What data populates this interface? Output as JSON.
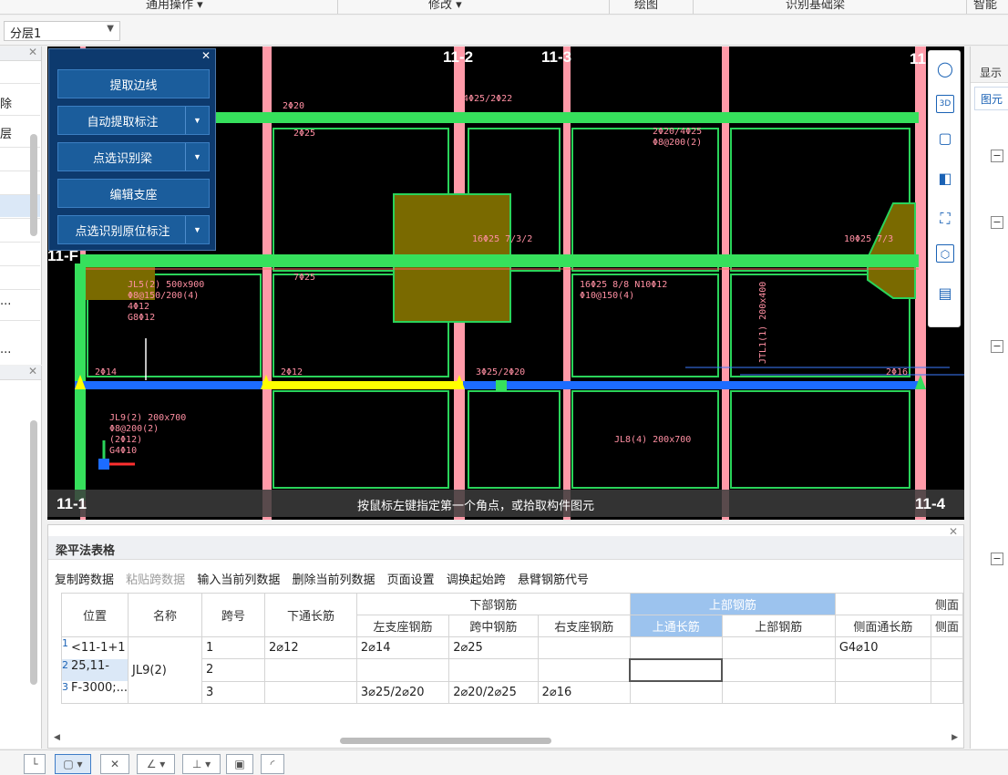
{
  "ribbon": {
    "items": [
      "通用操作 ▾",
      "修改 ▾",
      "绘图",
      "识别基础梁",
      "智能布"
    ]
  },
  "layer": {
    "selected": "分层1"
  },
  "left_panel": {
    "labels": [
      "除",
      "层",
      "...",
      "..."
    ]
  },
  "canvas": {
    "axis_labels": [
      "11-2",
      "11-3",
      "11-F",
      "11-1",
      "11-4",
      "11"
    ],
    "status_message": "按鼠标左键指定第一个角点，或拾取构件图元",
    "annotations": [
      "JL5(2) 500x900",
      "Φ8@150/200(4)",
      "4Φ12",
      "G8Φ12",
      "JL9(2) 200x700",
      "Φ8@200(2)",
      "(2Φ12)",
      "G4Φ10",
      "JL8(4) 200x700",
      "JTL1(1) 200x400",
      "16Φ25 7/3/2",
      "16Φ25 8/8 N10Φ12",
      "Φ10@150(4)",
      "4Φ25/2Φ22",
      "3Φ25/2Φ20",
      "2Φ20/4Φ25",
      "Φ8@200(2)",
      "2Φ20",
      "2Φ25",
      "7Φ25",
      "2Φ14",
      "2Φ12",
      "2Φ16",
      "10Φ25 7/3"
    ]
  },
  "tool_panel": {
    "buttons": [
      {
        "label": "提取边线",
        "dropdown": false
      },
      {
        "label": "自动提取标注",
        "dropdown": true
      },
      {
        "label": "点选识别梁",
        "dropdown": true
      },
      {
        "label": "编辑支座",
        "dropdown": false
      },
      {
        "label": "点选识别原位标注",
        "dropdown": true
      }
    ]
  },
  "right_toolbar": {
    "icons": [
      "orbit-icon",
      "3d-view-icon",
      "box-view-icon",
      "solid-view-icon",
      "zoom-extents-icon",
      "display-filter-icon",
      "properties-sheet-icon"
    ],
    "badge_3d": "3D"
  },
  "right_panel": {
    "title": "显示",
    "tab": "图元"
  },
  "beam_table": {
    "title": "梁平法表格",
    "actions": [
      {
        "label": "复制跨数据",
        "enabled": true
      },
      {
        "label": "粘贴跨数据",
        "enabled": false
      },
      {
        "label": "输入当前列数据",
        "enabled": true
      },
      {
        "label": "删除当前列数据",
        "enabled": true
      },
      {
        "label": "页面设置",
        "enabled": true
      },
      {
        "label": "调换起始跨",
        "enabled": true
      },
      {
        "label": "悬臂钢筋代号",
        "enabled": true
      }
    ],
    "headers": {
      "position": "位置",
      "name": "名称",
      "span": "跨号",
      "bottom_through": "下通长筋",
      "bottom_group": "下部钢筋",
      "left_support": "左支座钢筋",
      "mid_span": "跨中钢筋",
      "right_support": "右支座钢筋",
      "top_group": "上部钢筋",
      "top_through": "上通长筋",
      "top_bar": "上部钢筋",
      "side_group": "侧面",
      "side_through": "侧面通长筋",
      "side_extra": "侧面"
    },
    "position_lines": [
      "<11-1+1",
      "25,11-",
      "F-3000;..."
    ],
    "name": "JL9(2)",
    "rows": [
      {
        "num": "1",
        "span": "1",
        "bottom_through": "2⌀12",
        "left_support": "2⌀14",
        "mid_span": "2⌀25",
        "right_support": "",
        "top_through": "",
        "top_bar": "",
        "side_through": "G4⌀10"
      },
      {
        "num": "2",
        "span": "2",
        "bottom_through": "",
        "left_support": "",
        "mid_span": "",
        "right_support": "",
        "top_through": "",
        "top_bar": "",
        "side_through": ""
      },
      {
        "num": "3",
        "span": "3",
        "bottom_through": "",
        "left_support": "3⌀25/2⌀20",
        "mid_span": "2⌀20/2⌀25",
        "right_support": "2⌀16",
        "top_through": "",
        "top_bar": "",
        "side_through": ""
      }
    ]
  },
  "bottom_toolbar": {
    "icons": [
      "wall-corner-icon",
      "select-rect-icon",
      "cross-icon",
      "angle-icon",
      "axis-tool-icon",
      "save-view-icon",
      "arc-tool-icon"
    ]
  }
}
